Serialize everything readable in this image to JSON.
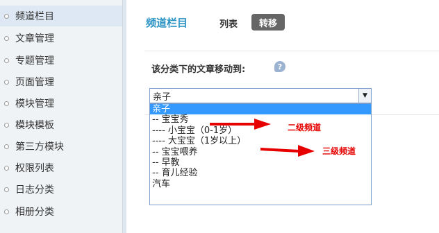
{
  "sidebar": {
    "items": [
      {
        "label": "频道栏目",
        "active": true
      },
      {
        "label": "文章管理"
      },
      {
        "label": "专题管理"
      },
      {
        "label": "页面管理"
      },
      {
        "label": "模块管理"
      },
      {
        "label": "模块模板"
      },
      {
        "label": "第三方模块"
      },
      {
        "label": "权限列表"
      },
      {
        "label": "日志分类"
      },
      {
        "label": "相册分类"
      }
    ]
  },
  "header": {
    "title": "频道栏目",
    "tabs": [
      {
        "label": "列表"
      },
      {
        "label": "转移",
        "active": true
      }
    ]
  },
  "form": {
    "label": "该分类下的文章移动到:",
    "help_icon_text": "?",
    "select_value": "亲子",
    "options": [
      "亲子",
      "-- 宝宝秀",
      "---- 小宝宝（0-1岁）",
      "---- 大宝宝（1岁以上）",
      "-- 宝宝喂养",
      "-- 早教",
      "-- 育儿经验",
      "汽车"
    ]
  },
  "annotations": {
    "level2": "二级频道",
    "level3": "三级频道",
    "color": "#e60000"
  },
  "colors": {
    "accent": "#2a93c4",
    "selected": "#3399ff",
    "sidebar_bg": "#f0f3f6"
  }
}
